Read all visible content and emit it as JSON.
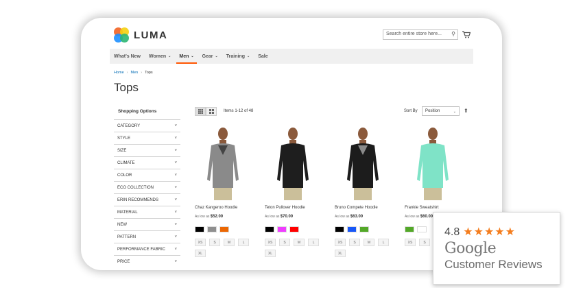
{
  "brand": {
    "name": "LUMA"
  },
  "search": {
    "placeholder": "Search entire store here..."
  },
  "nav": {
    "items": [
      {
        "label": "What's New",
        "has_menu": false
      },
      {
        "label": "Women",
        "has_menu": true
      },
      {
        "label": "Men",
        "has_menu": true,
        "active": true
      },
      {
        "label": "Gear",
        "has_menu": true
      },
      {
        "label": "Training",
        "has_menu": true
      },
      {
        "label": "Sale",
        "has_menu": false
      }
    ]
  },
  "breadcrumb": {
    "home": "Home",
    "men": "Men",
    "current": "Tops"
  },
  "page": {
    "title": "Tops"
  },
  "sidebar": {
    "title": "Shopping Options",
    "filters": [
      "Category",
      "Style",
      "Size",
      "Climate",
      "Color",
      "Eco Collection",
      "Erin Recommends",
      "Material",
      "New",
      "Pattern",
      "Performance Fabric",
      "Price"
    ]
  },
  "toolbar": {
    "items_count": "Items 1-12 of 48",
    "sort_label": "Sort By",
    "sort_value": "Position"
  },
  "products": [
    {
      "name": "Chaz Kangeroo Hoodie",
      "price_prefix": "As low as",
      "price": "$52.00",
      "garment": "#8a8a8a",
      "accent": "#444444",
      "swatches": [
        "#000000",
        "#8f8f8f",
        "#eb6703"
      ],
      "sizes": [
        "XS",
        "S",
        "M",
        "L",
        "XL"
      ]
    },
    {
      "name": "Teton Pullover Hoodie",
      "price_prefix": "As low as",
      "price": "$70.00",
      "garment": "#1e1e1e",
      "accent": "#1e1e1e",
      "swatches": [
        "#000000",
        "#ef3dff",
        "#ff0000"
      ],
      "sizes": [
        "XS",
        "S",
        "M",
        "L",
        "XL"
      ]
    },
    {
      "name": "Bruno Compete Hoodie",
      "price_prefix": "As low as",
      "price": "$63.00",
      "garment": "#1c1c1c",
      "accent": "#8a8a8a",
      "swatches": [
        "#000000",
        "#1857f7",
        "#53a828"
      ],
      "sizes": [
        "XS",
        "S",
        "M",
        "L",
        "XL"
      ]
    },
    {
      "name": "Frankie Sweatshirt",
      "price_prefix": "As low as",
      "price": "$60.00",
      "garment": "#7fe3c7",
      "accent": "#7fe3c7",
      "swatches": [
        "#53a828",
        "#ffffff"
      ],
      "sizes": [
        "XS",
        "S",
        "XL"
      ]
    }
  ],
  "reviews_badge": {
    "rating": "4.8",
    "stars": 5,
    "brand": "Google",
    "label": "Customer Reviews"
  },
  "colors": {
    "accent": "#ff5501",
    "link": "#006bb4",
    "star": "#f47d1e"
  }
}
